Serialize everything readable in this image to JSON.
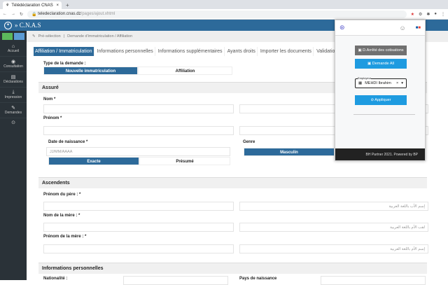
{
  "browser": {
    "tab_title": "Télédéclaration CNAS",
    "url_host": "teledeclaration.cnas.dz",
    "url_path": "/pages/ajout.xhtml"
  },
  "app": {
    "brand": "C.N.A.S"
  },
  "sidebar": {
    "items": [
      {
        "icon": "home-icon",
        "label": "Accueil"
      },
      {
        "icon": "eye-icon",
        "label": "Consultation"
      },
      {
        "icon": "file-icon",
        "label": "Déclarations"
      },
      {
        "icon": "download-icon",
        "label": "Impression"
      },
      {
        "icon": "edit-icon",
        "label": "Demandes"
      }
    ]
  },
  "breadcrumb": {
    "items": [
      "Pré-sélection",
      "Demande d'immatriculation / Affiliation"
    ]
  },
  "tabs": [
    "Affiliation / Immatriculation",
    "Informations personnelles",
    "Informations supplémentaires",
    "Ayants droits",
    "Importer les documents",
    "Validation"
  ],
  "form": {
    "type_label": "Type de la demande :",
    "type_options": [
      "Nouvelle immatriculation",
      "Affiliation"
    ],
    "assure_title": "Assuré",
    "nom_label": "Nom *",
    "prenom_label": "Prénom *",
    "dob_label": "Date de naissance *",
    "dob_placeholder": "JJ/MM/AAAA",
    "dob_options": [
      "Exacte",
      "Présumé"
    ],
    "genre_label": "Genre",
    "genre_value": "Masculin",
    "ascendents_title": "Ascendents",
    "pere_label": "Prénom du père : *",
    "pere_ar_placeholder": "إسم الأب باللغة العربية",
    "mere_nom_label": "Nom de la mère : *",
    "mere_nom_ar_placeholder": "لقب الأم باللغة العربية",
    "mere_prenom_label": "Prénom de la mère : *",
    "mere_prenom_ar_placeholder": "إسم الأم باللغة العربية",
    "info_title": "Informations personnelles",
    "nationalite_label": "Nationalité :",
    "pays_label": "Pays de naissance"
  },
  "popup": {
    "btn1": "D.Arrêté des cotisations",
    "btn2": "Demande All",
    "select_label": "Employeur",
    "select_value": "MEHDI Ibrahim",
    "apply": "Appliquer",
    "footer": "BH Partner 2021. Powered by BP"
  },
  "colors": {
    "primary": "#2d6a9a",
    "popup_blue": "#1e9be0",
    "sidebar": "#2a3238"
  }
}
